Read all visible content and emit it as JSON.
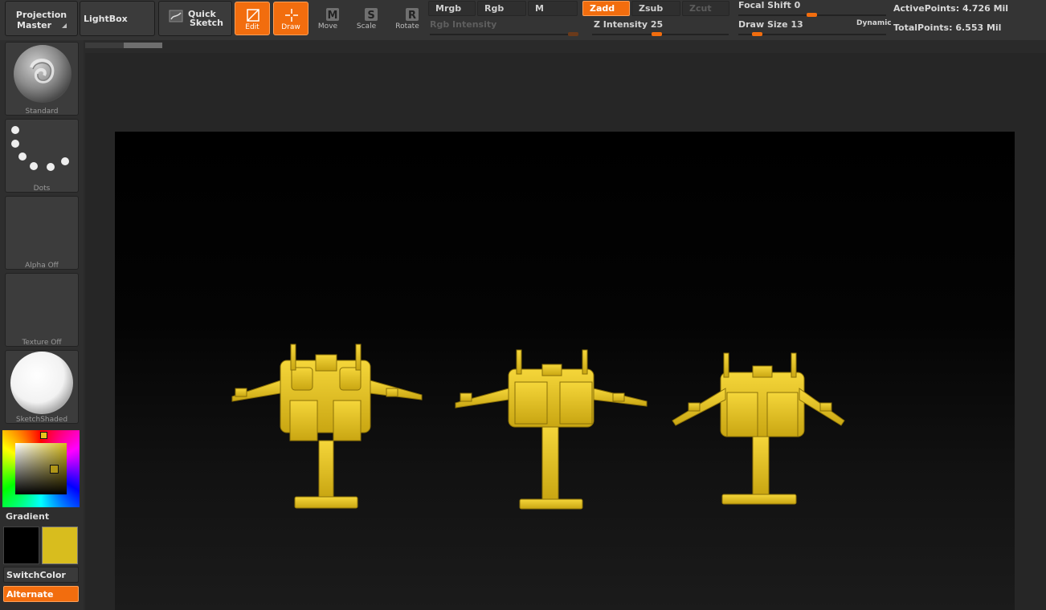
{
  "toolbar": {
    "projection_master_line1": "Projection",
    "projection_master_line2": "Master",
    "lightbox": "LightBox",
    "quick_sketch_line1": "Quick",
    "quick_sketch_line2": "Sketch",
    "tools": [
      {
        "label": "Edit",
        "active": true,
        "icon": "edit-icon"
      },
      {
        "label": "Draw",
        "active": true,
        "icon": "draw-icon"
      },
      {
        "label": "Move",
        "active": false,
        "icon": "move-icon"
      },
      {
        "label": "Scale",
        "active": false,
        "icon": "scale-icon"
      },
      {
        "label": "Rotate",
        "active": false,
        "icon": "rotate-icon"
      }
    ],
    "modes": {
      "mrgb": "Mrgb",
      "rgb": "Rgb",
      "m": "M",
      "zadd": "Zadd",
      "zsub": "Zsub",
      "zcut": "Zcut"
    },
    "rgb_intensity_label": "Rgb Intensity",
    "z_intensity_label": "Z Intensity",
    "z_intensity_value": "25",
    "focal_shift_label": "Focal Shift",
    "focal_shift_value": "0",
    "draw_size_label": "Draw Size",
    "draw_size_value": "13",
    "dynamic_label": "Dynamic",
    "active_points_label": "ActivePoints:",
    "active_points_value": "4.726 Mil",
    "total_points_label": "TotalPoints:",
    "total_points_value": "6.553 Mil"
  },
  "shelf": {
    "brush_label": "Standard",
    "stroke_label": "Dots",
    "alpha_label": "Alpha  Off",
    "texture_label": "Texture  Off",
    "material_label": "SketchShaded",
    "gradient_label": "Gradient",
    "switch_color_label": "SwitchColor",
    "alternate_label": "Alternate"
  },
  "colors": {
    "accent": "#f26d0e",
    "primary_color": "#d8bd1e",
    "secondary_color": "#000000",
    "model_color": "#e3c21a"
  }
}
